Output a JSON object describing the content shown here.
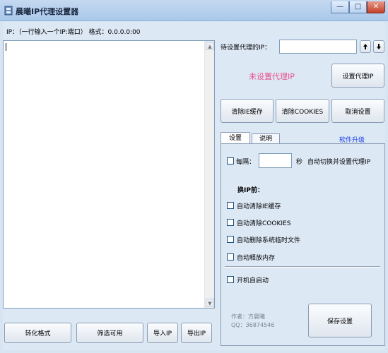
{
  "window": {
    "title": "晨曦IP代理设置器",
    "min": "—",
    "max": "□",
    "close": "✕"
  },
  "icons": {
    "app": "app-icon",
    "up": "up-arrow-icon",
    "down": "down-arrow-icon"
  },
  "left": {
    "ip_format_label": "IP：（一行输入一个IP:端口） 格式：0.0.0.0:00",
    "textarea_value": "",
    "buttons": {
      "convert": "转化格式",
      "filter": "筛选可用",
      "import": "导入IP",
      "export": "导出IP"
    }
  },
  "right": {
    "pending_ip_label": "待设置代理的IP：",
    "pending_ip_value": "",
    "status": "未设置代理IP",
    "set_proxy": "设置代理IP",
    "clear_ie": "清除IE缓存",
    "clear_cookies": "清除COOKIES",
    "cancel": "取消设置",
    "tabs": [
      "设置",
      "说明"
    ],
    "upgrade": "软件升级",
    "settings": {
      "every": "每隔：",
      "interval_value": "",
      "seconds": "秒",
      "auto_switch": "自动切换并设置代理IP",
      "before_switch": "换IP前：",
      "options": [
        "自动清除IE缓存",
        "自动清除COOKIES",
        "自动删除系统临时文件",
        "自动释放内存"
      ],
      "startup": "开机自启动",
      "author": "作者：方晨曦",
      "qq": "QQ：36874546",
      "save": "保存设置"
    }
  },
  "colors": {
    "status": "#e8508c",
    "link": "#1a3ee6",
    "accent": "#1c5180"
  }
}
